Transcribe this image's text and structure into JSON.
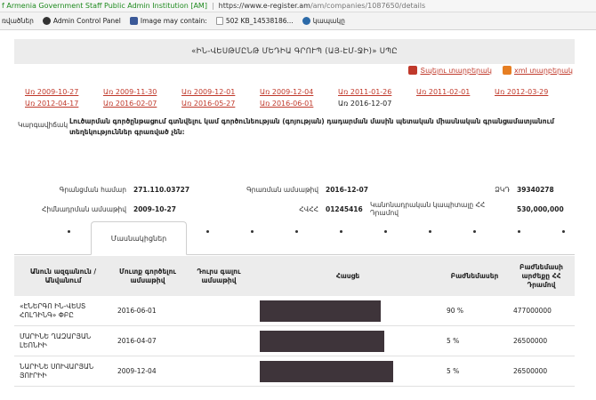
{
  "browser": {
    "secure_label": "f Armenia Government Staff Public Admin Institution [AM]",
    "separator": "|",
    "url_host": "https://www.e-register.am",
    "url_path": "/am/companies/1087650/details"
  },
  "bookmarks": [
    {
      "label": "ռվածներ",
      "icon": "folder-icon"
    },
    {
      "label": "Admin Control Panel",
      "icon": "admin-icon"
    },
    {
      "label": "Image may contain:",
      "icon": "facebook-icon"
    },
    {
      "label": "502 KB_14538186...",
      "icon": "file-icon"
    },
    {
      "label": "կապակը",
      "icon": "globe-icon"
    }
  ],
  "page": {
    "title": "«ԻՆ-ՎԵՍԹՄԸՆԹ ՄԵԴԻԱ ԳՐՈՒՊ (ԱՅ-ԷՄ-ՋԻ)» ՍՊԸ",
    "print_label": "Տպելու տարբերակ",
    "xml_label": "xml տարբերակ"
  },
  "dates": {
    "links": [
      "Առ 2009-10-27",
      "Առ 2009-11-30",
      "Առ 2009-12-01",
      "Առ 2009-12-04",
      "Առ 2011-01-26",
      "Առ 2011-02-01",
      "Առ 2012-03-29",
      "Առ 2012-04-17",
      "Առ 2016-02-07",
      "Առ 2016-05-27",
      "Առ 2016-06-01"
    ],
    "current": "Առ 2016-12-07"
  },
  "info": {
    "status_label": "Կարգավիճակ",
    "status_value": "Լուծարման գործընթացում գտնվելու կամ գործունեության (գոյության) դադարման մասին պետական միասնական գրանցամատյանում տեղեկություններ գրառված չեն։",
    "reg_no_label": "Գրանցման համար",
    "reg_no_value": "271.110.03727",
    "reg_date_label": "Գրառման ամսաթիվ",
    "reg_date_value": "2016-12-07",
    "tax_label": "ՁԿԴ",
    "tax_value": "39340278",
    "state_reg_date_label": "Հիմնադրման ամսաթիվ",
    "state_reg_date_value": "2009-10-27",
    "tin_label": "ՀՎՀՀ",
    "tin_value": "01245416",
    "capital_label": "Կանոնադրական կապիտալը ՀՀ Դրամով",
    "capital_value": "530,000,000"
  },
  "tabs": {
    "active_label": "Մասնակիցներ"
  },
  "participants": {
    "headers": [
      "Անուն ազգանուն / Անվանում",
      "Մուտք գործելու ամսաթիվ",
      "Դուրս գալու ամսաթիվ",
      "Հասցե",
      "Բաժնեմասեր",
      "Բաժնեմասի արժեքը ՀՀ Դրամով"
    ],
    "rows": [
      {
        "name": "«ԷՆԵՐԳՈ ԻՆ-ՎԵՍՏ ՀՈԼԴԻՆԳ» ՓԲԸ",
        "entry": "2016-06-01",
        "exit": "",
        "share": "90 %",
        "value": "477000000"
      },
      {
        "name": "ՄԱՐԻՆԵ ՂԱԶԱՐՅԱՆ ԼԵՈՆԻԻ",
        "entry": "2016-04-07",
        "exit": "",
        "share": "5 %",
        "value": "26500000"
      },
      {
        "name": "ՆԱՐԻՆԵ ՍՈՒՎԱՐՅԱՆ ՅՈՒՐԻԻ",
        "entry": "2009-12-04",
        "exit": "",
        "share": "5 %",
        "value": "26500000"
      }
    ]
  },
  "colors": {
    "link": "#c0392b",
    "header_bg": "#ececec",
    "redaction": "#3e343a"
  }
}
